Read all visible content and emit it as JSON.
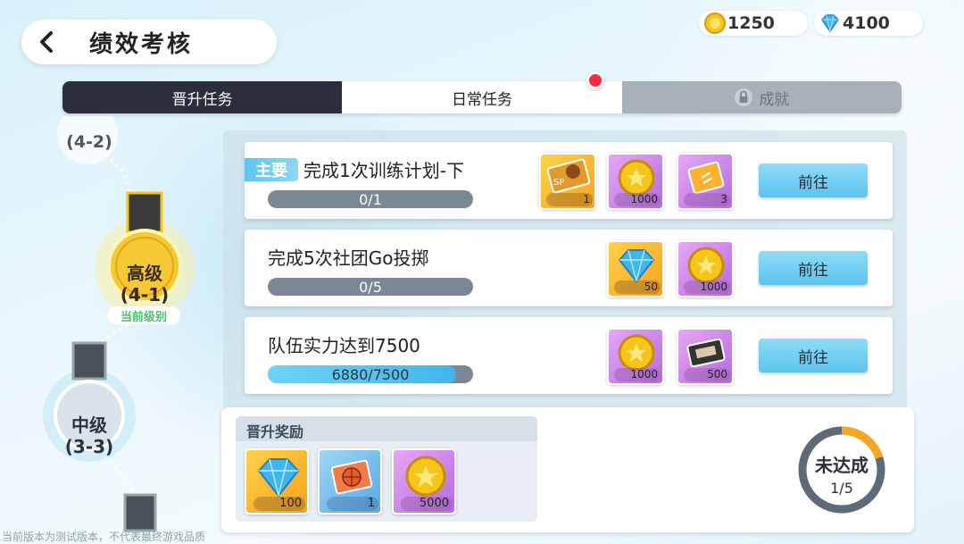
{
  "header": {
    "title": "绩效考核",
    "back_icon": "chevron-left-icon"
  },
  "currency": {
    "gold": {
      "icon": "gold-coin-icon",
      "value": "1250"
    },
    "gem": {
      "icon": "diamond-icon",
      "value": "4100"
    }
  },
  "tabs": [
    {
      "label": "晋升任务",
      "state": "active"
    },
    {
      "label": "日常任务",
      "state": "normal",
      "has_notification": true
    },
    {
      "label": "成就",
      "state": "locked",
      "icon": "lock-icon"
    }
  ],
  "levels": {
    "top_partial": "(4-2)",
    "current": {
      "name": "高级",
      "code": "(4-1)",
      "badge": "当前级别"
    },
    "next": {
      "name": "中级",
      "code": "(3-3)"
    }
  },
  "tasks": [
    {
      "tag": "主要",
      "name": "完成1次训练计划-下",
      "progress_text": "0/1",
      "progress": 0,
      "rewards": [
        {
          "icon": "sp-ticket-icon",
          "qty": "1",
          "frame": "orange"
        },
        {
          "icon": "gold-coin-icon",
          "qty": "1000",
          "frame": "purple"
        },
        {
          "icon": "ticket-icon",
          "qty": "3",
          "frame": "purple"
        }
      ],
      "button": "前往"
    },
    {
      "tag": "",
      "name": "完成5次社团Go投掷",
      "progress_text": "0/5",
      "progress": 0,
      "rewards": [
        {
          "icon": "diamond-icon",
          "qty": "50",
          "frame": "orange"
        },
        {
          "icon": "gold-coin-icon",
          "qty": "1000",
          "frame": "purple"
        }
      ],
      "button": "前往"
    },
    {
      "tag": "",
      "name": "队伍实力达到7500",
      "progress_text": "6880/7500",
      "progress": 0.917,
      "rewards": [
        {
          "icon": "gold-coin-icon",
          "qty": "1000",
          "frame": "purple"
        },
        {
          "icon": "video-tape-icon",
          "qty": "500",
          "frame": "purple"
        }
      ],
      "button": "前往"
    }
  ],
  "promotion": {
    "title": "晋升奖励",
    "rewards": [
      {
        "icon": "diamond-icon",
        "qty": "100",
        "frame": "orange"
      },
      {
        "icon": "basketball-ticket-icon",
        "qty": "1",
        "frame": "blue"
      },
      {
        "icon": "gold-coin-icon",
        "qty": "5000",
        "frame": "purple"
      }
    ],
    "status": "未达成",
    "count": "1/5",
    "progress": 0.2
  },
  "watermark": "当前版本为测试版本，不代表最终游戏品质",
  "colors": {
    "accent": "#5cc3ee",
    "dark_tab": "#2a2f3b",
    "ring": "#f5a623",
    "notify": "#ff2b3a"
  }
}
